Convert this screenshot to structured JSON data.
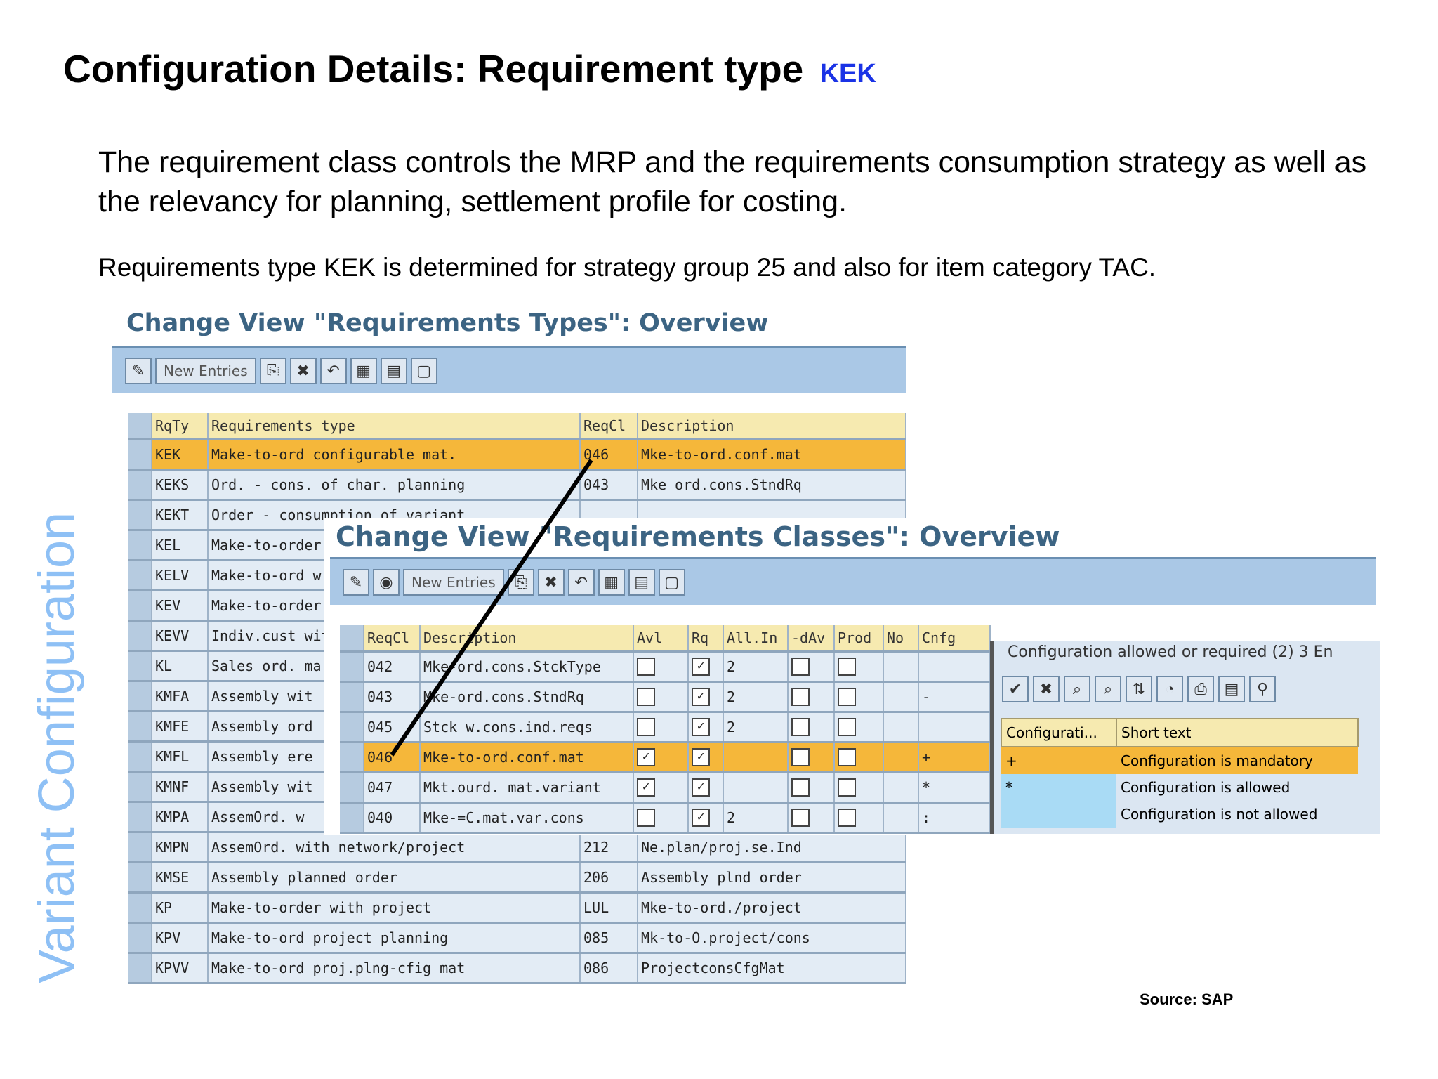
{
  "title": "Configuration Details: Requirement type",
  "title_highlight": "KEK",
  "para1": "The requirement class controls the MRP and the requirements consumption strategy as well as the relevancy for planning, settlement profile for costing.",
  "para2": "Requirements type KEK is determined for strategy group 25 and also for item category TAC.",
  "sidebar": "Variant Configuration",
  "source": "Source: SAP",
  "types_window": {
    "title": "Change View \"Requirements Types\": Overview",
    "new_entries": "New Entries",
    "headers": [
      "RqTy",
      "Requirements type",
      "ReqCl",
      "Description"
    ],
    "rows": [
      [
        "KEK",
        "Make-to-ord configurable mat.",
        "046",
        "Mke-to-ord.conf.mat"
      ],
      [
        "KEKS",
        "Ord. - cons. of char. planning",
        "043",
        "Mke ord.cons.StndRq"
      ],
      [
        "KEKT",
        "Order - consumption of variant",
        "",
        ""
      ],
      [
        "KEL",
        "Make-to-order",
        "",
        ""
      ],
      [
        "KELV",
        "Make-to-ord w.",
        "",
        ""
      ],
      [
        "KEV",
        "Make-to-order",
        "",
        ""
      ],
      [
        "KEVV",
        "Indiv.cust with",
        "",
        ""
      ],
      [
        "KL",
        "Sales ord. ma",
        "",
        ""
      ],
      [
        "KMFA",
        "Assembly wit",
        "",
        ""
      ],
      [
        "KMFE",
        "Assembly ord",
        "",
        ""
      ],
      [
        "KMFL",
        "Assembly ere",
        "",
        ""
      ],
      [
        "KMNF",
        "Assembly wit",
        "",
        ""
      ],
      [
        "KMPA",
        "AssemOrd. w",
        "",
        ""
      ],
      [
        "KMPN",
        "AssemOrd. with network/project",
        "212",
        "Ne.plan/proj.se.Ind"
      ],
      [
        "KMSE",
        "Assembly planned order",
        "206",
        "Assembly plnd order"
      ],
      [
        "KP",
        "Make-to-order with project",
        "LUL",
        "Mke-to-ord./project"
      ],
      [
        "KPV",
        "Make-to-ord project planning",
        "085",
        "Mk-to-O.project/cons"
      ],
      [
        "KPVV",
        "Make-to-ord proj.plng-cfig mat",
        "086",
        "ProjectconsCfgMat"
      ]
    ]
  },
  "classes_window": {
    "title": "Change View \"Requirements Classes\": Overview",
    "new_entries": "New Entries",
    "headers": [
      "ReqCl",
      "Description",
      "Avl",
      "Rq",
      "All.In",
      "-dAv",
      "Prod",
      "No",
      "Cnfg"
    ],
    "rows": [
      [
        "042",
        "Mke-ord.cons.StckType",
        false,
        true,
        "2",
        false,
        false,
        ""
      ],
      [
        "043",
        "Mke-ord.cons.StndRq",
        false,
        true,
        "2",
        false,
        false,
        "-"
      ],
      [
        "045",
        "Stck w.cons.ind.reqs",
        false,
        true,
        "2",
        false,
        false,
        ""
      ],
      [
        "046",
        "Mke-to-ord.conf.mat",
        true,
        true,
        "",
        false,
        false,
        "+"
      ],
      [
        "047",
        "Mkt.ourd. mat.variant",
        true,
        true,
        "",
        false,
        false,
        "*"
      ],
      [
        "040",
        "Mke-=C.mat.var.cons",
        false,
        true,
        "2",
        false,
        false,
        ":"
      ]
    ]
  },
  "popup": {
    "title": "Configuration allowed or required (2)   3 En",
    "headers": [
      "Configurati...",
      "Short text"
    ],
    "rows": [
      [
        "+",
        "Configuration is mandatory"
      ],
      [
        "*",
        "Configuration is allowed"
      ],
      [
        "",
        "Configuration is not allowed"
      ]
    ]
  }
}
